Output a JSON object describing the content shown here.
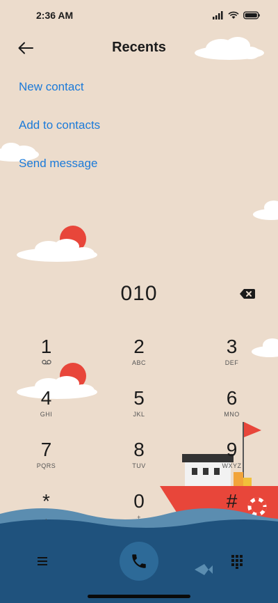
{
  "status_bar": {
    "time": "2:36 AM"
  },
  "header": {
    "title": "Recents"
  },
  "actions": {
    "new_contact": "New contact",
    "add_to_contacts": "Add to contacts",
    "send_message": "Send message"
  },
  "dialer": {
    "number": "010"
  },
  "keypad": [
    {
      "digit": "1",
      "letters": ""
    },
    {
      "digit": "2",
      "letters": "ABC"
    },
    {
      "digit": "3",
      "letters": "DEF"
    },
    {
      "digit": "4",
      "letters": "GHI"
    },
    {
      "digit": "5",
      "letters": "JKL"
    },
    {
      "digit": "6",
      "letters": "MNO"
    },
    {
      "digit": "7",
      "letters": "PQRS"
    },
    {
      "digit": "8",
      "letters": "TUV"
    },
    {
      "digit": "9",
      "letters": "WXYZ"
    },
    {
      "digit": "*",
      "letters": ","
    },
    {
      "digit": "0",
      "letters": "+"
    },
    {
      "digit": "#",
      "letters": ""
    }
  ],
  "icons": {
    "back": "arrow-left-icon",
    "backspace": "backspace-icon",
    "voicemail": "voicemail-icon",
    "menu": "hamburger-menu-icon",
    "call": "phone-icon",
    "keypad": "dialpad-icon"
  },
  "colors": {
    "background": "#ecdccc",
    "link": "#1b7ad9",
    "sea": "#1f527d",
    "call_button": "#2d6a98"
  }
}
